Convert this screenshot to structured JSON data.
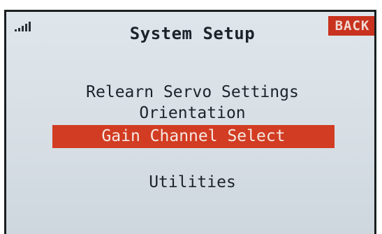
{
  "header": {
    "title": "System Setup",
    "back_label": "BACK"
  },
  "status": {
    "signal_icon": "signal-strength-icon"
  },
  "menu": {
    "items": [
      {
        "label": "Relearn Servo Settings",
        "selected": false
      },
      {
        "label": "Orientation",
        "selected": false
      },
      {
        "label": "Gain Channel Select",
        "selected": true
      },
      {
        "label": "Utilities",
        "selected": false
      }
    ]
  },
  "colors": {
    "highlight": "#d23c22",
    "back_button": "#c8321e",
    "screen_bg": "#d9e0e6"
  }
}
